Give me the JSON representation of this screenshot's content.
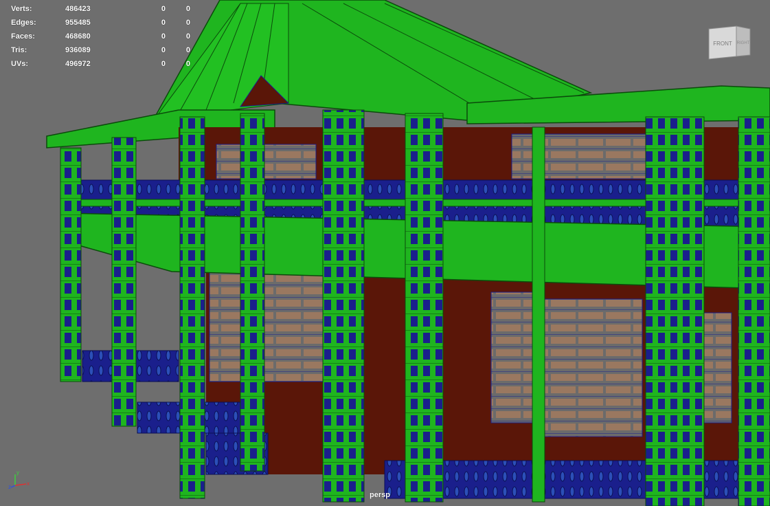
{
  "hud": {
    "rows": [
      {
        "label": "Verts:",
        "v1": "486423",
        "v2": "0",
        "v3": "0"
      },
      {
        "label": "Edges:",
        "v1": "955485",
        "v2": "0",
        "v3": "0"
      },
      {
        "label": "Faces:",
        "v1": "468680",
        "v2": "0",
        "v3": "0"
      },
      {
        "label": "Tris:",
        "v1": "936089",
        "v2": "0",
        "v3": "0"
      },
      {
        "label": "UVs:",
        "v1": "496972",
        "v2": "0",
        "v3": "0"
      }
    ]
  },
  "viewport": {
    "camera_label": "persp",
    "viewcube_front": "FRONT",
    "viewcube_right": "RIGHT",
    "axis_x": "x",
    "axis_y": "y",
    "axis_z": "z"
  },
  "colors": {
    "background": "#6e6e6e",
    "wireframe_green": "#1fb51f",
    "wireframe_blue": "#1a1f8c",
    "wall_brown": "#5a1608",
    "window_grey": "#6a6a6a"
  }
}
